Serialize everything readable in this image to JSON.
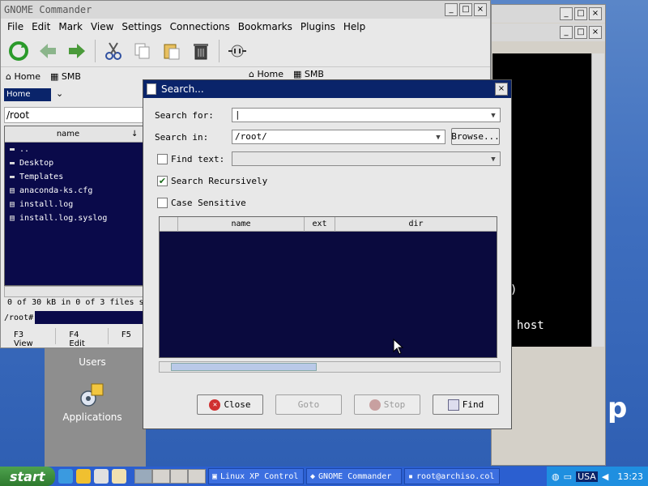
{
  "desktop": {
    "users_label": "Users",
    "applications_label": "Applications",
    "big_letter": "p"
  },
  "terminal": {
    "line1": ")",
    "line2": "host"
  },
  "commander": {
    "title": "GNOME Commander",
    "menu": [
      "File",
      "Edit",
      "Mark",
      "View",
      "Settings",
      "Connections",
      "Bookmarks",
      "Plugins",
      "Help"
    ],
    "device_left": [
      "Home",
      "SMB"
    ],
    "device_right": [
      "Home",
      "SMB"
    ],
    "bookmark_combo": "Home",
    "path": "/root",
    "column_name": "name",
    "files": [
      {
        "name": "..",
        "icon": "folder-icon"
      },
      {
        "name": "Desktop",
        "icon": "folder-icon"
      },
      {
        "name": "Templates",
        "icon": "folder-icon"
      },
      {
        "name": "anaconda-ks.cfg",
        "icon": "file-icon"
      },
      {
        "name": "install.log",
        "icon": "file-icon"
      },
      {
        "name": "install.log.syslog",
        "icon": "file-icon"
      }
    ],
    "status": "0 of 30 kB in 0 of 3 files s",
    "prompt": "/root#",
    "fkeys": [
      "F3 View",
      "F4 Edit",
      "F5"
    ]
  },
  "search": {
    "title": "Search...",
    "search_for_label": "Search for:",
    "search_for_value": "",
    "search_in_label": "Search in:",
    "search_in_value": "/root/",
    "browse_label": "Browse...",
    "find_text_label": "Find text:",
    "find_text_checked": false,
    "recursive_label": "Search Recursively",
    "recursive_checked": true,
    "case_label": "Case Sensitive",
    "case_checked": false,
    "columns": [
      "name",
      "ext",
      "dir"
    ],
    "buttons": {
      "close": "Close",
      "goto": "Goto",
      "stop": "Stop",
      "find": "Find"
    }
  },
  "taskbar": {
    "start_label": "start",
    "tasks": [
      "Linux XP Control",
      "GNOME Commander",
      "root@archiso.col"
    ],
    "language": "USA",
    "clock": "13:23"
  },
  "colors": {
    "title_active": "#0a246a",
    "list_bg": "#0a0a4a",
    "taskbar": "#2b5fd0",
    "start_green": "#3c8f3c"
  }
}
